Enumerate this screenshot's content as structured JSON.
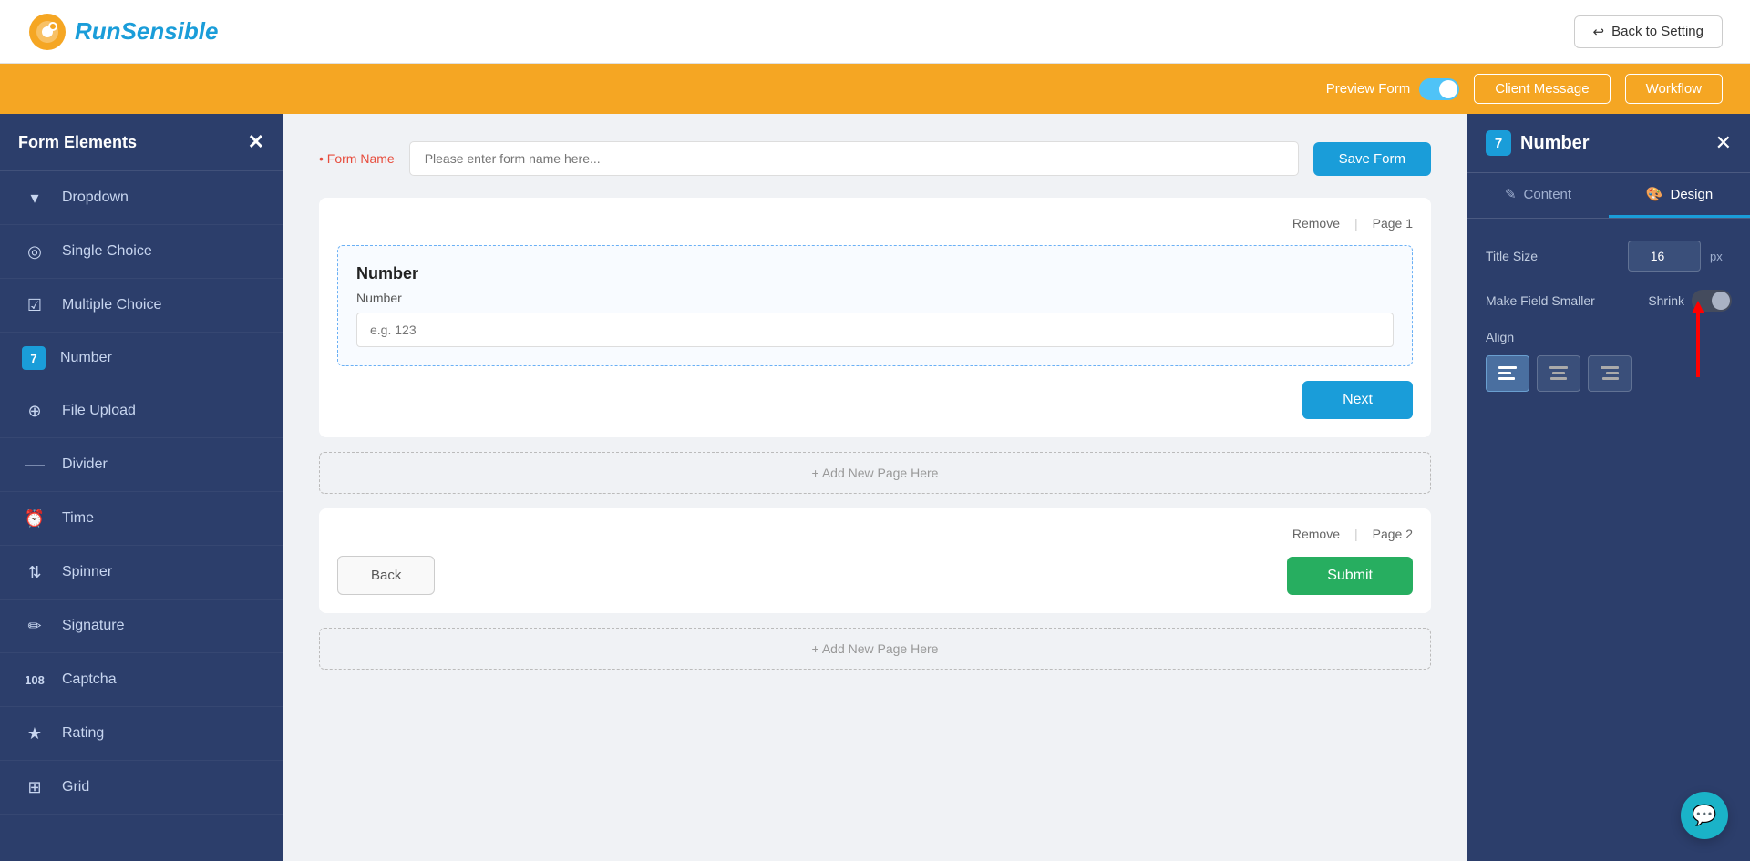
{
  "header": {
    "logo_text": "RunSensible",
    "back_btn_label": "Back to Setting"
  },
  "orange_bar": {
    "preview_form_label": "Preview Form",
    "client_message_label": "Client Message",
    "workflow_label": "Workflow"
  },
  "sidebar": {
    "title": "Form Elements",
    "items": [
      {
        "id": "dropdown",
        "label": "Dropdown",
        "icon": "▾"
      },
      {
        "id": "single-choice",
        "label": "Single Choice",
        "icon": "◎"
      },
      {
        "id": "multiple-choice",
        "label": "Multiple Choice",
        "icon": "☑"
      },
      {
        "id": "number",
        "label": "Number",
        "icon": "7"
      },
      {
        "id": "file-upload",
        "label": "File Upload",
        "icon": "⊕"
      },
      {
        "id": "divider",
        "label": "Divider",
        "icon": "—"
      },
      {
        "id": "time",
        "label": "Time",
        "icon": "🕐"
      },
      {
        "id": "spinner",
        "label": "Spinner",
        "icon": "⇅"
      },
      {
        "id": "signature",
        "label": "Signature",
        "icon": "✏"
      },
      {
        "id": "captcha",
        "label": "Captcha",
        "icon": "🔢"
      },
      {
        "id": "rating",
        "label": "Rating",
        "icon": "★"
      },
      {
        "id": "grid",
        "label": "Grid",
        "icon": "⊞"
      }
    ]
  },
  "form_area": {
    "form_name_label": "• Form Name",
    "form_name_placeholder": "Please enter form name here...",
    "save_form_btn": "Save Form",
    "page1": {
      "remove_label": "Remove",
      "page_label": "Page 1",
      "element": {
        "title": "Number",
        "field_label": "Number",
        "field_placeholder": "e.g. 123"
      },
      "next_btn": "Next"
    },
    "add_page_label": "+ Add New Page Here",
    "page2": {
      "remove_label": "Remove",
      "page_label": "Page 2",
      "back_btn": "Back",
      "submit_btn": "Submit"
    },
    "add_page_label2": "+ Add New Page Here"
  },
  "right_panel": {
    "badge": "7",
    "title": "Number",
    "close_icon": "✕",
    "tabs": [
      {
        "id": "content",
        "label": "Content",
        "icon": "✎"
      },
      {
        "id": "design",
        "label": "Design",
        "icon": "🎨"
      }
    ],
    "active_tab": "design",
    "title_size_label": "Title Size",
    "title_size_value": "16",
    "title_size_unit": "px",
    "make_field_smaller_label": "Make Field Smaller",
    "shrink_label": "Shrink",
    "align_label": "Align",
    "align_options": [
      "left",
      "center",
      "right"
    ]
  }
}
